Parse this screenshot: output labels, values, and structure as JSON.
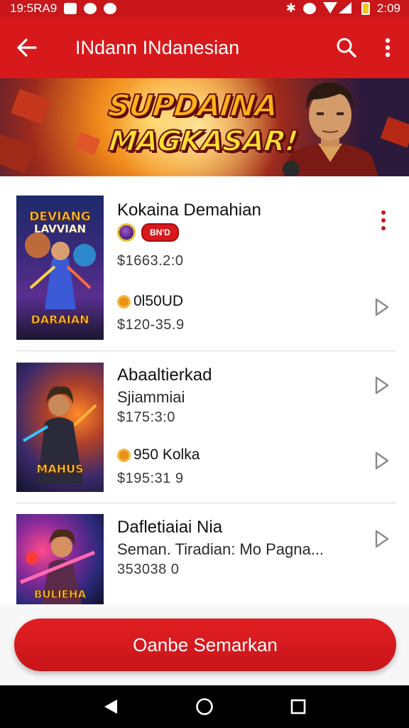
{
  "status_bar": {
    "time_left": "19:5RA9",
    "time_right": "2:09"
  },
  "app_bar": {
    "title": "INdann INdanesian",
    "back_icon": "arrow-left-icon",
    "search_icon": "search-icon",
    "menu_icon": "more-vert-icon"
  },
  "banner": {
    "title_line1": "SUPDAINA",
    "title_line2": "MAGKASAR!"
  },
  "items": [
    {
      "cover_title": "DEVIANG",
      "cover_sub": "LAVVIAN",
      "cover_bottom": "DARAIAN",
      "title": "Kokaina Demahian",
      "badge": "BN'D",
      "price1": "$1663.2:0",
      "coin_text": "0l50UD",
      "price2": "$120-35.9"
    },
    {
      "cover_title": "",
      "cover_sub": "",
      "cover_bottom": "MAHUS",
      "title": "Abaaltierkad",
      "subtitle": "Sjiammiai",
      "price1": "$175:3:0",
      "coin_text": "950 Kolka",
      "price2": "$195:31 9"
    },
    {
      "cover_title": "",
      "cover_sub": "",
      "cover_bottom": "BULIEHA",
      "title": "Dafletiaiai Nia",
      "subtitle": "Seman. Tiradian: Mo Pagna...",
      "price1": "353038 0"
    }
  ],
  "cta": {
    "label": "Oanbe Semarkan"
  },
  "colors": {
    "primary": "#d7191c",
    "accent_gold": "#e89316"
  }
}
